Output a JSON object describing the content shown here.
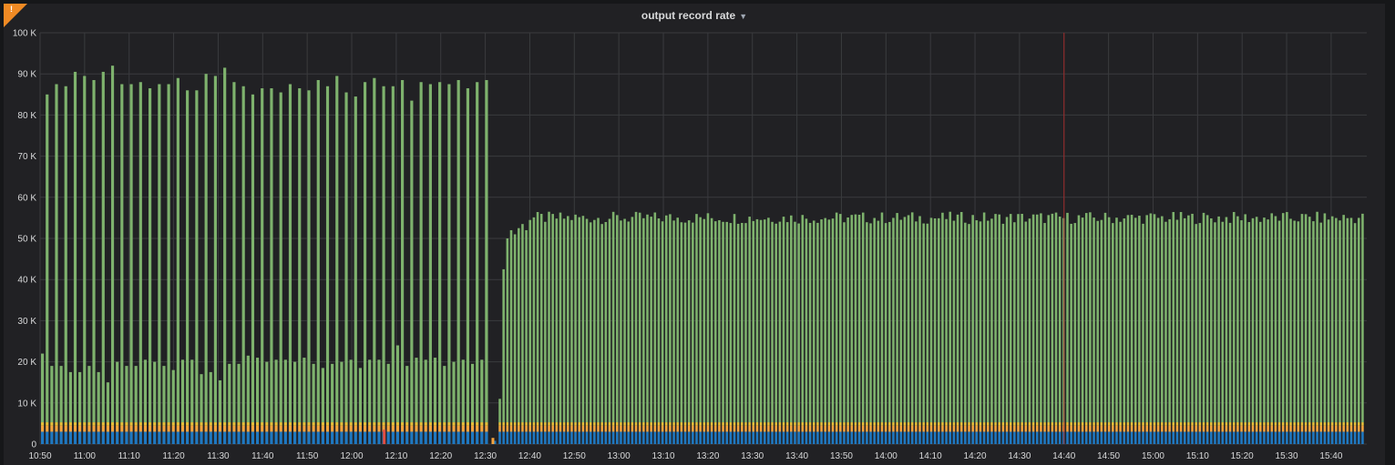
{
  "panel": {
    "title": "output record rate",
    "warning_icon": "alert-icon",
    "warning_text": "!"
  },
  "colors": {
    "background": "#212124",
    "grid": "#3a3b3e",
    "green": "#7eb26d",
    "orange": "#f4a43f",
    "yellow": "#e5c03b",
    "blue": "#1f78c1",
    "red": "#e24d42",
    "cyan": "#6ed0e0",
    "marker": "#9e2a2a"
  },
  "chart_data": {
    "type": "bar",
    "stacked": true,
    "ylim": [
      0,
      100000
    ],
    "y_ticks": [
      "0",
      "10 K",
      "20 K",
      "30 K",
      "40 K",
      "50 K",
      "60 K",
      "70 K",
      "80 K",
      "90 K",
      "100 K"
    ],
    "x_ticks": [
      "10:50",
      "11:00",
      "11:10",
      "11:20",
      "11:30",
      "11:40",
      "11:50",
      "12:00",
      "12:10",
      "12:20",
      "12:30",
      "12:40",
      "12:50",
      "13:00",
      "13:10",
      "13:20",
      "13:30",
      "13:40",
      "13:50",
      "14:00",
      "14:10",
      "14:20",
      "14:30",
      "14:40",
      "14:50",
      "15:00",
      "15:10",
      "15:20",
      "15:30",
      "15:40"
    ],
    "grid": true,
    "legend": "none",
    "time_start": "10:50",
    "time_end": "15:48",
    "marker_time": "14:40",
    "phase1": {
      "start": "10:50",
      "end": "12:31",
      "series": [
        {
          "color": "blue",
          "value": 3000
        },
        {
          "color": "orange",
          "value": 1500
        },
        {
          "color": "yellow",
          "value": 800
        }
      ],
      "green_odd_bars": [
        85000,
        87500,
        87000,
        90500,
        89500,
        88500,
        90500,
        92000,
        87500,
        87500,
        88000,
        86500,
        87500,
        87500,
        89000,
        86000,
        86000,
        90000,
        89500,
        91500,
        88000,
        87000,
        85000,
        86500,
        86500,
        85500,
        87500,
        86500,
        86000,
        88500,
        87000,
        89500,
        85500,
        84500,
        88000,
        89000,
        87000,
        87000,
        88500,
        83500,
        88000,
        87500,
        88000,
        87500,
        88500,
        86500,
        88000,
        88500
      ],
      "green_even_bars": [
        22000,
        19000,
        19000,
        17500,
        17500,
        19000,
        17500,
        15000,
        20000,
        19000,
        19000,
        20500,
        20000,
        19000,
        18000,
        20500,
        20500,
        17000,
        17500,
        15500,
        19500,
        19500,
        21500,
        21000,
        20000,
        20500,
        20500,
        20000,
        21000,
        19500,
        18500,
        19500,
        20000,
        20500,
        18500,
        20500,
        20500,
        19500,
        24000,
        19000,
        21000,
        20500,
        21000,
        19000,
        20000,
        20500,
        19500,
        20500
      ],
      "red_dip_time": "12:07"
    },
    "gap": {
      "start": "12:31",
      "end": "12:33"
    },
    "phase2": {
      "start": "12:33",
      "end": "15:48",
      "ramp": [
        11000,
        42500,
        50000,
        52000,
        51000,
        52500,
        53500,
        52000
      ],
      "steady_range": [
        52000,
        56500
      ],
      "series": [
        {
          "color": "blue",
          "value": 3000
        },
        {
          "color": "orange",
          "value": 1500
        },
        {
          "color": "yellow",
          "value": 800
        }
      ]
    }
  }
}
